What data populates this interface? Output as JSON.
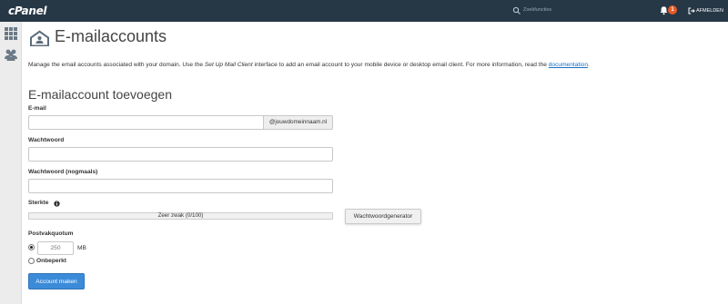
{
  "topbar": {
    "logo": "cPanel",
    "search_placeholder": "Zoekfuncties",
    "notification_count": "1",
    "logout_label": "AFMELDEN",
    "bg_color": "#263746",
    "badge_color": "#e45a26"
  },
  "sidebar": {
    "items": [
      {
        "icon": "grid-icon"
      },
      {
        "icon": "users-icon"
      }
    ]
  },
  "page": {
    "title": "E-mailaccounts",
    "description_before": "Manage the email accounts associated with your domain. Use the ",
    "description_italic": "Set Up Mail Client",
    "description_after": " interface to add an email account to your mobile device or desktop email client. For more information, read the ",
    "documentation_link": "documentation",
    "description_end": "."
  },
  "form": {
    "section_title": "E-mailaccount toevoegen",
    "email_label": "E-mail",
    "email_value": "",
    "domain_addon": "@jouwdomeinnaam.nl",
    "password_label": "Wachtwoord",
    "password_value": "",
    "password_confirm_label": "Wachtwoord (nogmaals)",
    "password_confirm_value": "",
    "strength_label": "Sterkte",
    "strength_text": "Zeer zwak (0/100)",
    "strength_value": 0,
    "generator_button": "Wachtwoordgenerator",
    "quota_label": "Postvakquotum",
    "quota_value": "250",
    "quota_unit": "MB",
    "quota_selected": "limited",
    "unlimited_label": "Onbeperkt",
    "submit_button": "Account maken",
    "accent_color": "#3b8bd9"
  }
}
